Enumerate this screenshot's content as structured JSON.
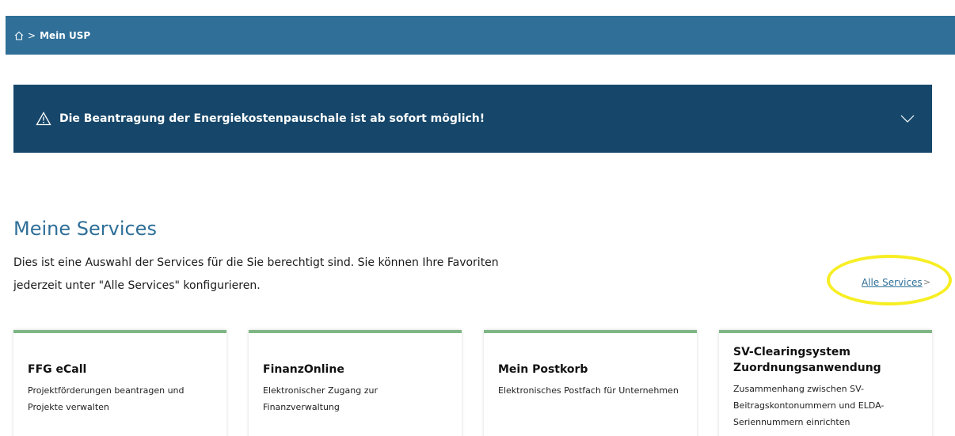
{
  "breadcrumb": {
    "home_icon": "home-icon",
    "separator": ">",
    "current": "Mein USP"
  },
  "alert": {
    "icon": "warning-icon",
    "text": "Die Beantragung der Energiekostenpauschale ist ab sofort möglich!",
    "toggle_icon": "chevron-down-icon"
  },
  "services": {
    "title": "Meine Services",
    "description": "Dies ist eine Auswahl der Services für die Sie berechtigt sind. Sie können Ihre Favoriten jederzeit unter \"Alle Services\" konfigurieren.",
    "all_services_link": "Alle Services",
    "all_services_chevron": ">"
  },
  "cards": [
    {
      "title": "FFG eCall",
      "description": "Projektförderungen beantragen und Projekte verwalten"
    },
    {
      "title": "FinanzOnline",
      "description": "Elektronischer Zugang zur Finanzverwaltung"
    },
    {
      "title": "Mein Postkorb",
      "description": "Elektronisches Postfach für Unternehmen"
    },
    {
      "title": "SV-Clearingsystem Zuordnungsanwendung",
      "description": "Zusammenhang zwischen SV-Beitragskontonummern und ELDA-Seriennummern einrichten"
    }
  ],
  "colors": {
    "brand_blue": "#2f6f98",
    "alert_bg": "#16476a",
    "card_accent": "#7fb685",
    "highlight": "#f7ee23"
  }
}
